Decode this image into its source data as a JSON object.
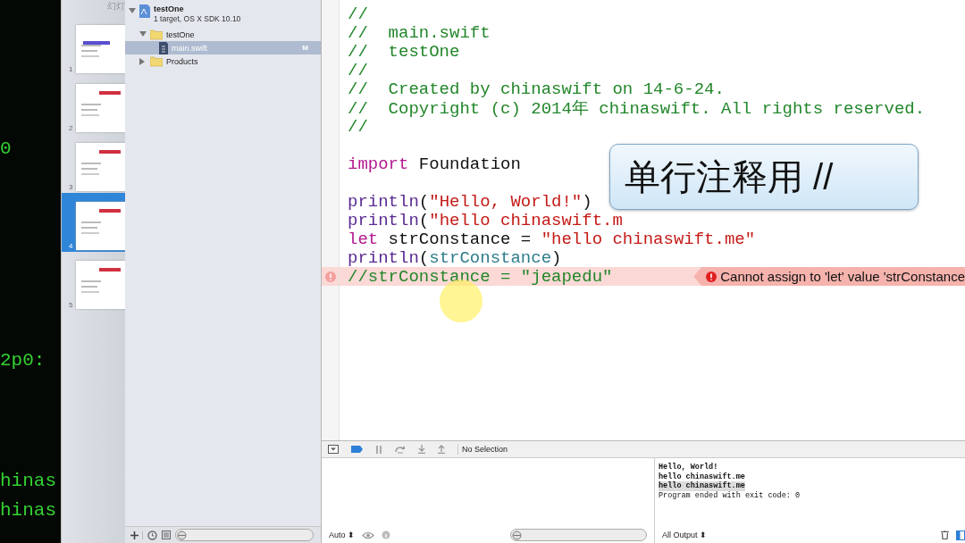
{
  "terminal": {
    "lines": [
      "0",
      "2p0:",
      "hinas",
      "hinas"
    ]
  },
  "slides_panel": {
    "header": "幻灯",
    "slides": [
      {
        "number": "1",
        "selected": false
      },
      {
        "number": "2",
        "selected": false
      },
      {
        "number": "3",
        "selected": false
      },
      {
        "number": "4",
        "selected": true
      },
      {
        "number": "5",
        "selected": false
      }
    ]
  },
  "navigator": {
    "project": {
      "name": "testOne",
      "subtitle": "1 target, OS X SDK 10.10",
      "expanded": true
    },
    "items": [
      {
        "kind": "folder",
        "name": "testOne",
        "expanded": true,
        "children": [
          {
            "kind": "file",
            "name": "main.swift",
            "badge": "M",
            "selected": true
          }
        ]
      },
      {
        "kind": "folder",
        "name": "Products",
        "expanded": false
      }
    ]
  },
  "editor": {
    "lines": [
      {
        "kind": "code",
        "segments": [
          {
            "kind": "comment",
            "text": "//"
          }
        ]
      },
      {
        "kind": "code",
        "segments": [
          {
            "kind": "comment",
            "text": "//  main.swift"
          }
        ]
      },
      {
        "kind": "code",
        "segments": [
          {
            "kind": "comment",
            "text": "//  testOne"
          }
        ]
      },
      {
        "kind": "code",
        "segments": [
          {
            "kind": "comment",
            "text": "//"
          }
        ]
      },
      {
        "kind": "code",
        "segments": [
          {
            "kind": "comment",
            "text": "//  Created by chinaswift on 14-6-24."
          }
        ]
      },
      {
        "kind": "code",
        "segments": [
          {
            "kind": "comment",
            "text": "//  Copyright (c) 2014年 chinaswift. All rights reserved."
          }
        ]
      },
      {
        "kind": "code",
        "segments": [
          {
            "kind": "comment",
            "text": "//"
          }
        ]
      },
      {
        "kind": "blank"
      },
      {
        "kind": "code",
        "segments": [
          {
            "kind": "keyword",
            "text": "import"
          },
          {
            "kind": "plain",
            "text": " Foundation"
          }
        ]
      },
      {
        "kind": "blank"
      },
      {
        "kind": "code",
        "segments": [
          {
            "kind": "func",
            "text": "println"
          },
          {
            "kind": "plain",
            "text": "("
          },
          {
            "kind": "string",
            "text": "\"Hello, World!\""
          },
          {
            "kind": "plain",
            "text": ")"
          }
        ]
      },
      {
        "kind": "code",
        "segments": [
          {
            "kind": "func",
            "text": "println"
          },
          {
            "kind": "plain",
            "text": "("
          },
          {
            "kind": "string",
            "text": "\"hello chinaswift.m"
          }
        ]
      },
      {
        "kind": "code",
        "segments": [
          {
            "kind": "keyword",
            "text": "let"
          },
          {
            "kind": "plain",
            "text": " strConstance = "
          },
          {
            "kind": "string",
            "text": "\"hello chinaswift.me\""
          }
        ]
      },
      {
        "kind": "code",
        "segments": [
          {
            "kind": "func",
            "text": "println"
          },
          {
            "kind": "plain",
            "text": "("
          },
          {
            "kind": "ident",
            "text": "strConstance"
          },
          {
            "kind": "plain",
            "text": ")"
          }
        ]
      },
      {
        "kind": "code",
        "segments": [
          {
            "kind": "comment",
            "text": "//strConstance = \"jeapedu\""
          }
        ],
        "error": true,
        "message": "Cannot assign to 'let' value 'strConstance"
      }
    ],
    "callout": "单行注释用 //"
  },
  "debug_bar": {
    "status": "No Selection"
  },
  "console": {
    "lines": [
      {
        "text": "Hello, World!",
        "bold": true,
        "highlighted": false
      },
      {
        "text": "hello chinaswift.me",
        "bold": true,
        "highlighted": false
      },
      {
        "text": "hello chinaswift.me",
        "bold": true,
        "highlighted": true
      },
      {
        "text": "Program ended with exit code: 0",
        "bold": false,
        "highlighted": false
      }
    ]
  },
  "variables_footer": {
    "scope": "Auto ⬍"
  },
  "console_footer": {
    "filter": "All Output ⬍"
  }
}
